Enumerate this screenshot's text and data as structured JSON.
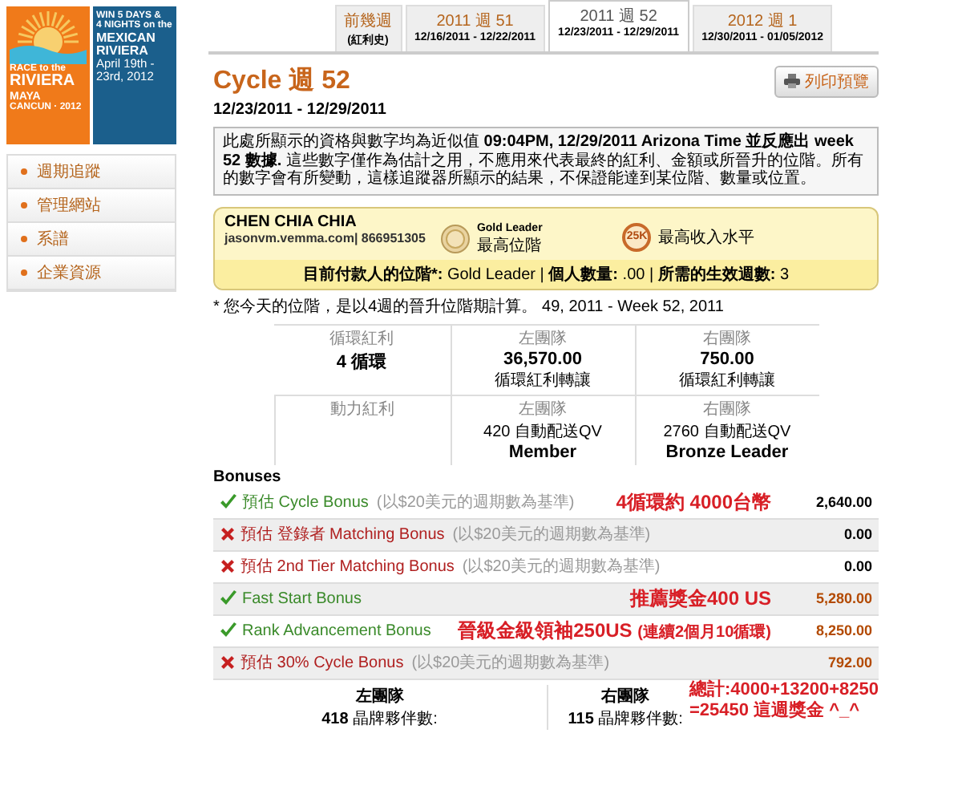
{
  "ad": {
    "left_lines": [
      "RACE to the",
      "RIVIERA",
      "MAYA",
      "CANCUN · 2012"
    ],
    "right_lines": [
      "WIN 5 DAYS &",
      "4 NIGHTS on the",
      "MEXICAN",
      "RIVIERA",
      "April 19th -",
      "23rd, 2012"
    ]
  },
  "sidebar": {
    "items": [
      "週期追蹤",
      "管理網站",
      "系譜",
      "企業資源"
    ]
  },
  "tabs": [
    {
      "label": "前幾週",
      "sub": "(紅利史)",
      "selected": false
    },
    {
      "label": "2011 週 51",
      "sub": "12/16/2011 - 12/22/2011",
      "selected": false
    },
    {
      "label": "2011 週 52",
      "sub": "12/23/2011 - 12/29/2011",
      "selected": true
    },
    {
      "label": "2012 週 1",
      "sub": "12/30/2011 - 01/05/2012",
      "selected": false
    }
  ],
  "title": "Cycle 週 52",
  "print_button": "列印預覽",
  "date_range": "12/23/2011 - 12/29/2011",
  "notice": "此處所顯示的資格與數字均為近似值 **09:04PM, 12/29/2011 Arizona Time 並反應出 week 52 數據.** 這些數字僅作為估計之用，不應用來代表最終的紅利、金額或所晉升的位階。所有的數字會有所變動，這樣追蹤器所顯示的結果，不保證能達到某位階、數量或位置。",
  "member": {
    "name": "CHEN CHIA CHIA",
    "site": "jasonvm.vemma.com",
    "id": "| 866951305",
    "rank": "Gold Leader",
    "rank_sub": "最高位階",
    "income_badge": "25K",
    "income_label": "最高收入水平",
    "status": "**目前付款人的位階*:** Gold Leader | **個人數量:** .00 | **所需的生效週數:** 3"
  },
  "footnote": "* 您今天的位階，是以4週的晉升位階期計算。 49, 2011 - Week 52, 2011",
  "stats": [
    {
      "label": "循環紅利",
      "value": "4 循環",
      "cells": [
        [
          {
            "text": "左團隊",
            "kind": "caption"
          },
          {
            "text": "36,570.00",
            "kind": "big"
          },
          {
            "text": "循環紅利轉讓",
            "kind": "small"
          }
        ],
        [
          {
            "text": "右團隊",
            "kind": "caption"
          },
          {
            "text": "750.00",
            "kind": "big"
          },
          {
            "text": "循環紅利轉讓",
            "kind": "small"
          }
        ]
      ]
    },
    {
      "label": "動力紅利",
      "cells": [
        [
          {
            "text": "左團隊",
            "kind": "caption"
          },
          {
            "text": "420 自動配送QV",
            "kind": "small"
          },
          {
            "text": "Member",
            "kind": "big"
          }
        ],
        [
          {
            "text": "右團隊",
            "kind": "caption"
          },
          {
            "text": "2760 自動配送QV",
            "kind": "small"
          },
          {
            "text": "Bronze Leader",
            "kind": "big"
          }
        ]
      ]
    }
  ],
  "bonuses_title": "Bonuses",
  "bonuses": [
    {
      "earned": true,
      "label": "預估 Cycle Bonus",
      "note": "(以$20美元的週期數為基準)",
      "annotation": "4循環約 4000台幣",
      "value": "2,640.00",
      "accent": false
    },
    {
      "earned": false,
      "label": "預估 登錄者 Matching Bonus",
      "note": "(以$20美元的週期數為基準)",
      "value": "0.00",
      "accent": false
    },
    {
      "earned": false,
      "label": "預估 2nd Tier Matching Bonus",
      "note": "(以$20美元的週期數為基準)",
      "value": "0.00",
      "accent": false
    },
    {
      "earned": true,
      "label": "Fast Start Bonus",
      "annotation": "推薦獎金400 US",
      "value": "5,280.00",
      "accent": true
    },
    {
      "earned": true,
      "label": "Rank Advancement Bonus",
      "annotation": "晉級金級領袖250US",
      "annotation_note": "(連續2個月10循環)",
      "value": "8,250.00",
      "accent": true
    },
    {
      "earned": false,
      "label": "預估 30% Cycle Bonus",
      "note": "(以$20美元的週期數為基準)",
      "value": "792.00",
      "accent": true
    }
  ],
  "teams": [
    {
      "title": "左團隊",
      "count": "418",
      "count_label": "晶牌夥伴數:"
    },
    {
      "title": "右團隊",
      "count": "115",
      "count_label": "晶牌夥伴數:",
      "annotation": [
        "總計:4000+13200+8250",
        "=25450 這週獎金 ^_^"
      ]
    }
  ]
}
